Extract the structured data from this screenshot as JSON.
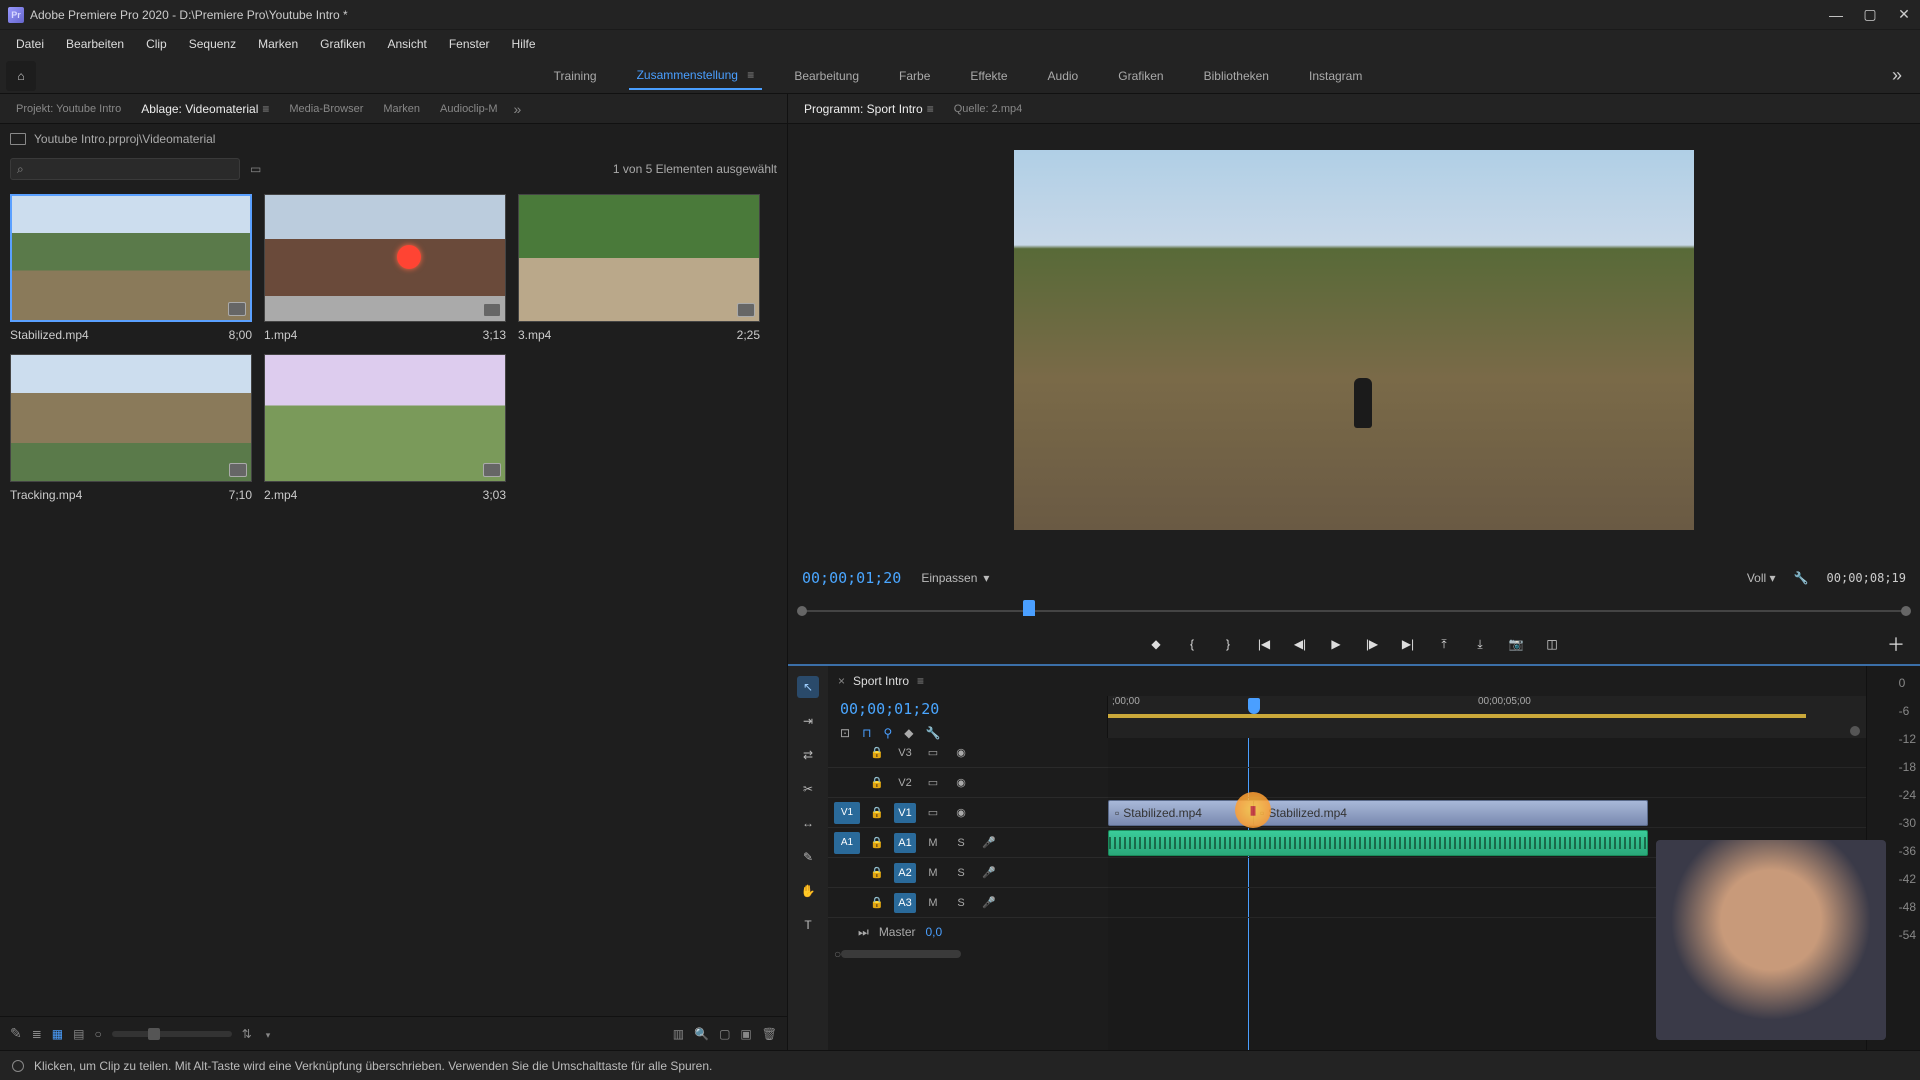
{
  "title": "Adobe Premiere Pro 2020 - D:\\Premiere Pro\\Youtube Intro *",
  "menu": [
    "Datei",
    "Bearbeiten",
    "Clip",
    "Sequenz",
    "Marken",
    "Grafiken",
    "Ansicht",
    "Fenster",
    "Hilfe"
  ],
  "workspaces": {
    "items": [
      "Training",
      "Zusammenstellung",
      "Bearbeitung",
      "Farbe",
      "Effekte",
      "Audio",
      "Grafiken",
      "Bibliotheken",
      "Instagram"
    ],
    "active": "Zusammenstellung"
  },
  "left_tabs": {
    "items": [
      "Projekt: Youtube Intro",
      "Ablage: Videomaterial",
      "Media-Browser",
      "Marken",
      "Audioclip-M"
    ],
    "active": "Ablage: Videomaterial"
  },
  "right_tabs": {
    "items": [
      "Programm: Sport Intro",
      "Quelle: 2.mp4"
    ],
    "active": "Programm: Sport Intro"
  },
  "bin": {
    "path": "Youtube Intro.prproj\\Videomaterial",
    "selection_info": "1 von 5 Elementen ausgewählt",
    "clips": [
      {
        "name": "Stabilized.mp4",
        "dur": "8;00",
        "selected": true,
        "thumb": "road"
      },
      {
        "name": "1.mp4",
        "dur": "3;13",
        "selected": false,
        "thumb": "wall"
      },
      {
        "name": "3.mp4",
        "dur": "2;25",
        "selected": false,
        "thumb": "field"
      },
      {
        "name": "Tracking.mp4",
        "dur": "7;10",
        "selected": false,
        "thumb": "curve"
      },
      {
        "name": "2.mp4",
        "dur": "3;03",
        "selected": false,
        "thumb": "field2"
      }
    ]
  },
  "program": {
    "current_tc": "00;00;01;20",
    "fit_label": "Einpassen",
    "resolution_label": "Voll",
    "duration_tc": "00;00;08;19"
  },
  "timeline": {
    "sequence_name": "Sport Intro",
    "current_tc": "00;00;01;20",
    "ruler": {
      "ticks": [
        ";00;00",
        "00;00;05;00"
      ]
    },
    "video_tracks": [
      "V3",
      "V2",
      "V1"
    ],
    "audio_tracks": [
      "A1",
      "A2",
      "A3"
    ],
    "source_patches": {
      "v": "V1",
      "a": "A1"
    },
    "clip_name_a": "Stabilized.mp4",
    "clip_name_b": "Stabilized.mp4",
    "master_label": "Master",
    "master_value": "0,0"
  },
  "meters_scale": [
    "0",
    "-6",
    "-12",
    "-18",
    "-24",
    "-30",
    "-36",
    "-42",
    "-48",
    "-54"
  ],
  "status": "Klicken, um Clip zu teilen. Mit Alt-Taste wird eine Verknüpfung überschrieben. Verwenden Sie die Umschalttaste für alle Spuren.",
  "icons": {
    "home": "⌂",
    "burger": "≡",
    "more": "»",
    "search": "⌕",
    "folder": "▭",
    "pencil": "✎",
    "list": "≣",
    "grid": "▦",
    "freeform": "▤",
    "sort": "⇅",
    "newitem": "▣",
    "newbin": "▢",
    "trash": "🗑",
    "zoom": "🔍",
    "mark_in": "{",
    "mark_out": "}",
    "go_in": "|◀",
    "step_back": "◀|",
    "play": "▶",
    "step_fwd": "|▶",
    "go_out": "▶|",
    "lift": "⤒",
    "extract": "⤓",
    "camera": "📷",
    "compare": "◫",
    "add": "＋",
    "wrench": "🔧",
    "chev": "▾",
    "selection": "↖",
    "track_select": "⇥",
    "ripple": "⇄",
    "razor": "✂",
    "slip": "↔",
    "pen": "✎",
    "hand": "✋",
    "type": "T",
    "snap": "⊓",
    "link": "⚲",
    "marker": "◆",
    "settings": "⚙",
    "close": "×",
    "lock": "🔒",
    "eye": "◉",
    "mute": "M",
    "solo": "S",
    "rec": "●",
    "sync": "▭"
  }
}
